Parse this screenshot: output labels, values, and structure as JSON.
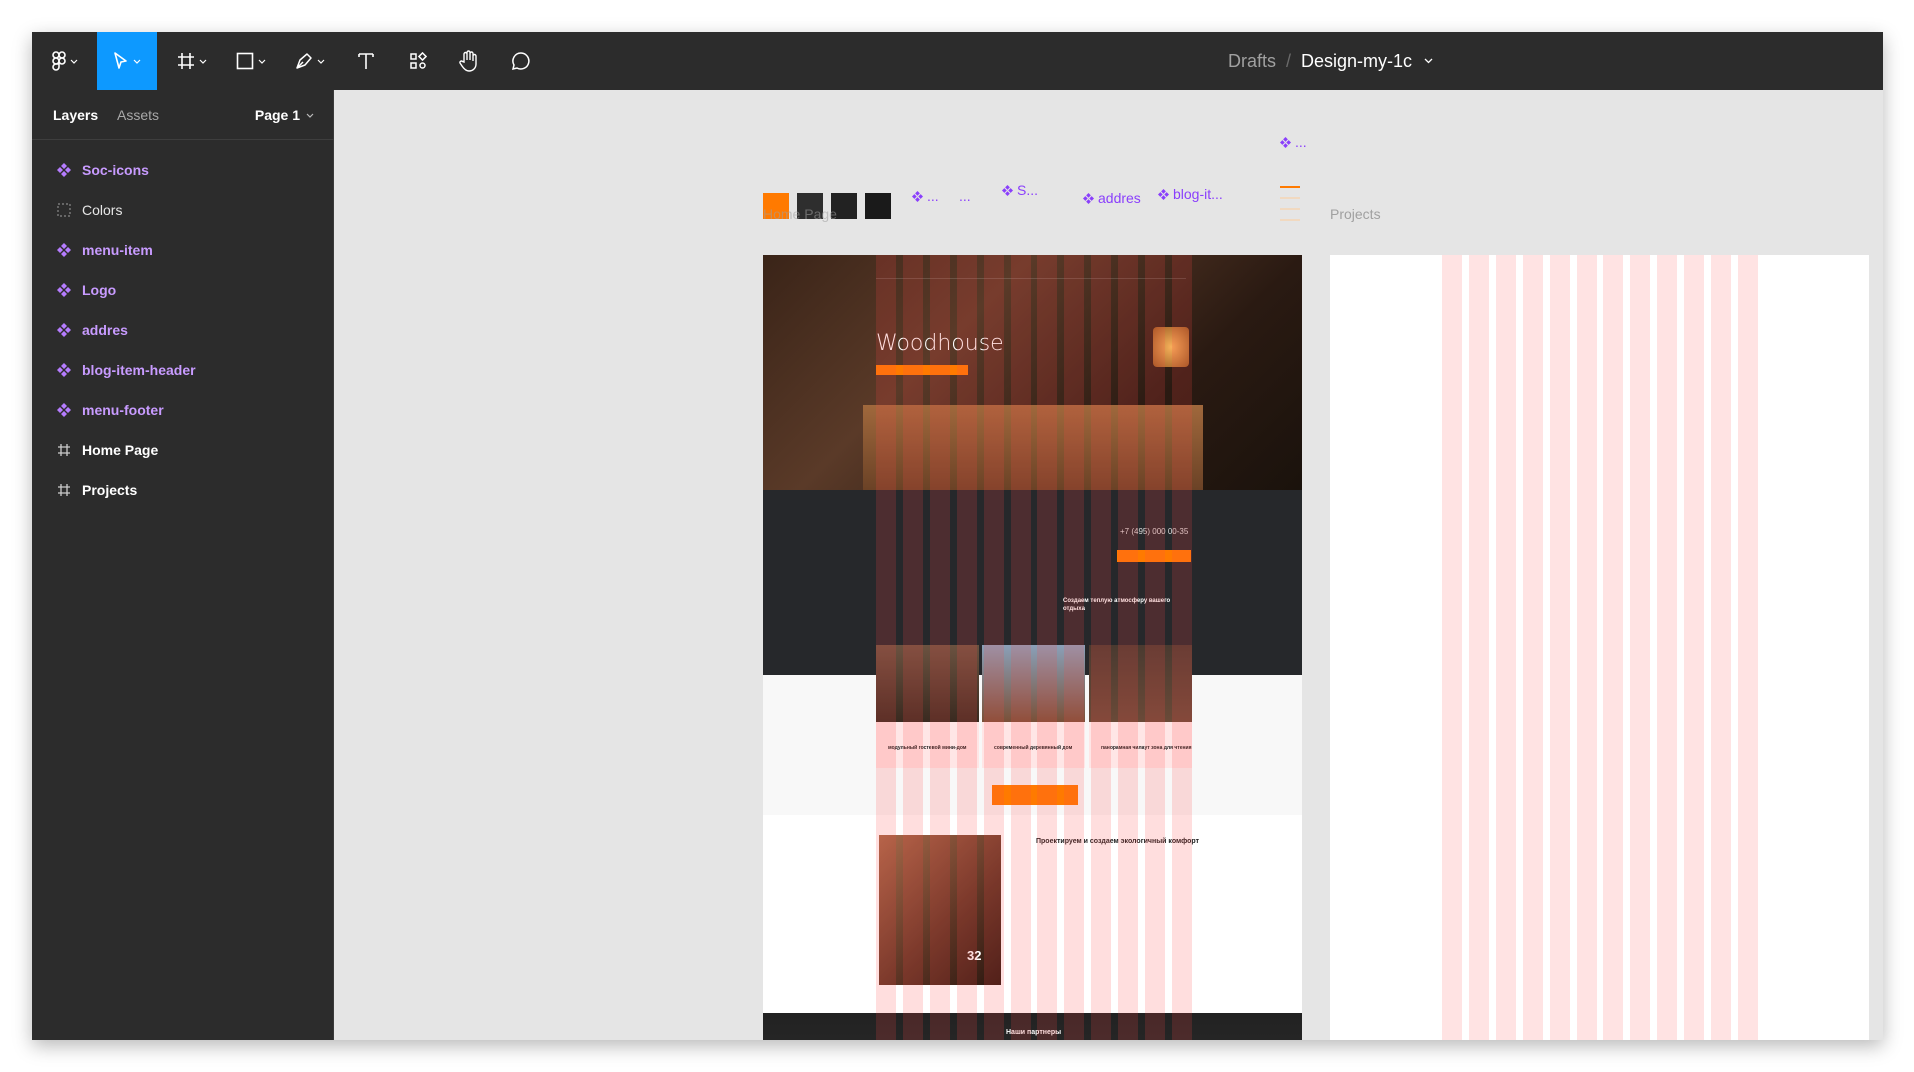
{
  "toolbar": {
    "breadcrumb_parent": "Drafts",
    "breadcrumb_separator": "/",
    "file_name": "Design-my-1c",
    "tools": [
      "figma-menu",
      "move",
      "frame",
      "shape",
      "pen",
      "text",
      "resources",
      "hand",
      "comment"
    ],
    "active_tool": "move",
    "active_color": "#0d99ff"
  },
  "sidebar": {
    "tab_layers": "Layers",
    "tab_assets": "Assets",
    "page_selector": "Page 1",
    "layers": [
      {
        "label": "Soc-icons",
        "kind": "component"
      },
      {
        "label": "Colors",
        "kind": "group"
      },
      {
        "label": "menu-item",
        "kind": "component"
      },
      {
        "label": "Logo",
        "kind": "component"
      },
      {
        "label": "addres",
        "kind": "component"
      },
      {
        "label": "blog-item-header",
        "kind": "component"
      },
      {
        "label": "menu-footer",
        "kind": "component"
      },
      {
        "label": "Home Page",
        "kind": "frame"
      },
      {
        "label": "Projects",
        "kind": "frame"
      }
    ]
  },
  "canvas": {
    "frame_home_label": "Home Page",
    "frame_projects_label": "Projects",
    "component_labels": {
      "c1": "...",
      "c2": "...",
      "c3": "S...",
      "c4": "addres",
      "c5": "blog-it...",
      "c6": "..."
    },
    "swatch_colors": [
      "#ff7a00",
      "#2e2e2e",
      "#222222",
      "#1a1a1a"
    ],
    "home_page": {
      "hero_title": "Woodhouse",
      "phone": "+7 (495) 000 00-35",
      "section_heading": "Создаем теплую атмосферу вашего отдыха",
      "cards": [
        "модульный гостевой мини-дом",
        "современный деревянный дом",
        "панорамная чилаут зона для чтения"
      ],
      "about_heading": "Проектируем и создаем экологичный комфорт",
      "years": "32",
      "partners_heading": "Наши партнеры"
    },
    "brand_color": "#ff7a00"
  }
}
